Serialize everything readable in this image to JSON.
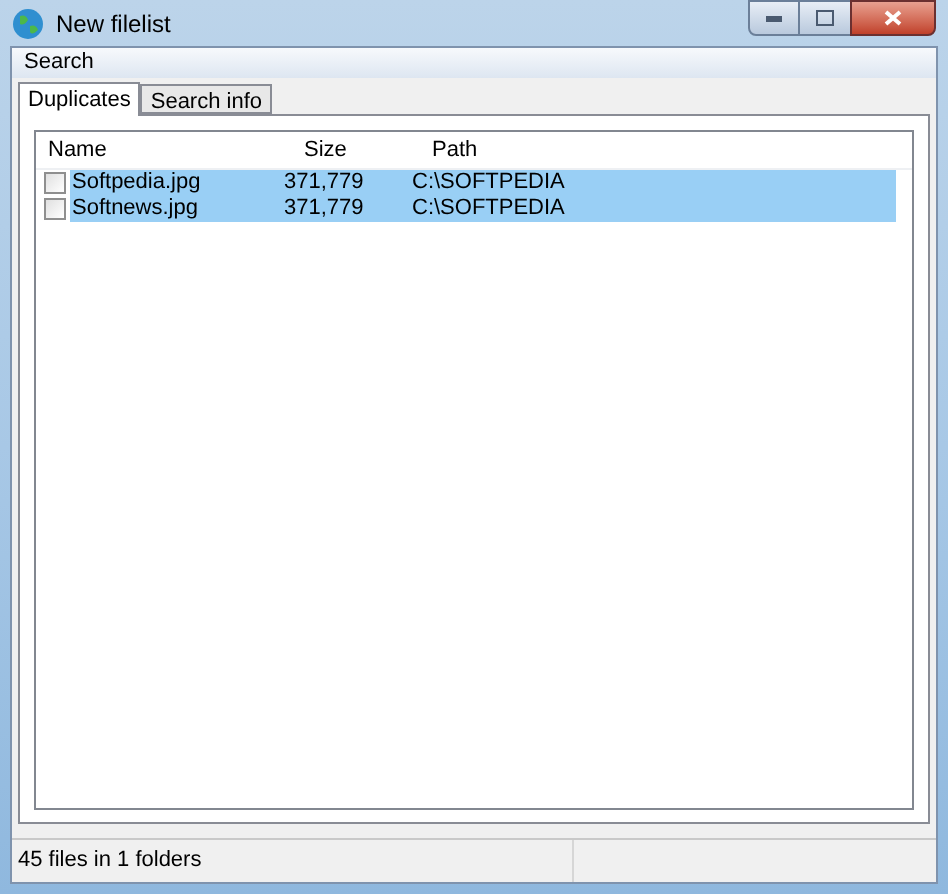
{
  "window": {
    "title": "New filelist"
  },
  "menu": [
    "Search"
  ],
  "tabs": [
    {
      "label": "Duplicates",
      "selected": true
    },
    {
      "label": "Search info",
      "selected": false
    }
  ],
  "table": {
    "columns": [
      "Name",
      "Size",
      "Path"
    ],
    "rows": [
      {
        "name": "Softpedia.jpg",
        "size": "371,779",
        "path": "C:\\SOFTPEDIA",
        "checked": false,
        "selected": true
      },
      {
        "name": "Softnews.jpg",
        "size": "371,779",
        "path": "C:\\SOFTPEDIA",
        "checked": false,
        "selected": true
      }
    ]
  },
  "status_bar": "45 files in 1 folders"
}
